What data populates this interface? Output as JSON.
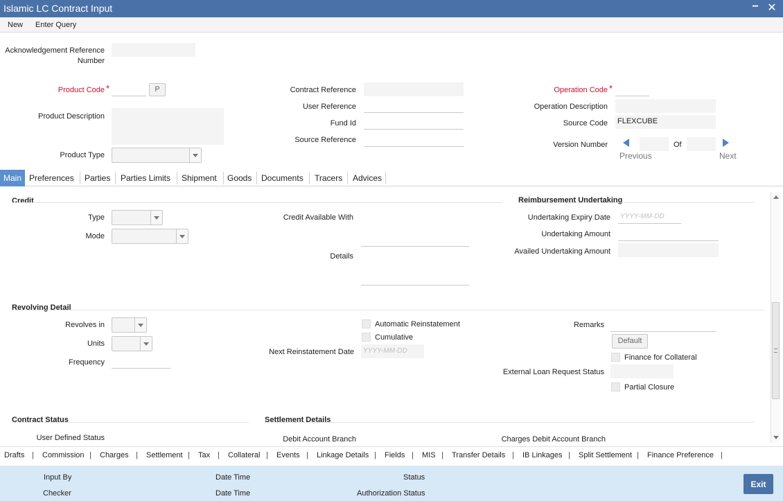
{
  "window": {
    "title": "Islamic LC Contract Input",
    "minimize": "−",
    "close": "✕"
  },
  "menu": {
    "new": "New",
    "enter_query": "Enter Query"
  },
  "header": {
    "ack_ref_label_1": "Acknowledgement Reference",
    "ack_ref_label_2": "Number",
    "product_code_label": "Product Code",
    "product_code_lookup": "P",
    "product_description_label": "Product Description",
    "product_type_label": "Product Type",
    "contract_reference_label": "Contract Reference",
    "user_reference_label": "User Reference",
    "fund_id_label": "Fund Id",
    "source_reference_label": "Source Reference",
    "operation_code_label": "Operation Code",
    "operation_description_label": "Operation Description",
    "source_code_label": "Source Code",
    "source_code_value": "FLEXCUBE",
    "version_number_label": "Version Number",
    "of_label": "Of",
    "previous_label": "Previous",
    "next_label": "Next",
    "required_mark": "*"
  },
  "tabs": [
    "Main",
    "Preferences",
    "Parties",
    "Parties Limits",
    "Shipment",
    "Goods",
    "Documents",
    "Tracers",
    "Advices"
  ],
  "credit": {
    "section_title": "Credit",
    "type_label": "Type",
    "mode_label": "Mode",
    "credit_available_with_label": "Credit Available With",
    "details_label": "Details"
  },
  "reimbursement": {
    "section_title": "Reimbursement Undertaking",
    "expiry_date_label": "Undertaking Expiry Date",
    "expiry_date_placeholder": "YYYY-MM-DD",
    "amount_label": "Undertaking Amount",
    "availed_amount_label": "Availed Undertaking Amount"
  },
  "revolving": {
    "section_title": "Revolving Detail",
    "revolves_in_label": "Revolves in",
    "units_label": "Units",
    "frequency_label": "Frequency",
    "automatic_reinstatement_label": "Automatic Reinstatement",
    "cumulative_label": "Cumulative",
    "next_reinstatement_date_label": "Next Reinstatement Date",
    "next_reinstatement_placeholder": "YYYY-MM-DD",
    "remarks_label": "Remarks",
    "default_button": "Default",
    "finance_for_collateral_label": "Finance for Collateral",
    "external_loan_status_label": "External Loan Request Status",
    "partial_closure_label": "Partial Closure"
  },
  "contract_status": {
    "section_title": "Contract Status",
    "user_defined_status_label": "User Defined Status"
  },
  "settlement": {
    "section_title": "Settlement Details",
    "debit_account_branch_label": "Debit Account Branch",
    "charges_debit_account_branch_label": "Charges Debit Account Branch"
  },
  "bottom_links": [
    "Drafts",
    "Commission",
    "Charges",
    "Settlement",
    "Tax",
    "Collateral",
    "Events",
    "Linkage Details",
    "Fields",
    "MIS",
    "Transfer Details",
    "IB Linkages",
    "Split Settlement",
    "Finance Preference"
  ],
  "bottom_separator": "|",
  "footer": {
    "input_by_label": "Input By",
    "checker_label": "Checker",
    "date_time_label_1": "Date Time",
    "date_time_label_2": "Date Time",
    "status_label": "Status",
    "authorization_status_label": "Authorization Status",
    "exit_button": "Exit"
  },
  "colors": {
    "titlebar": "#4a72a8",
    "active_tab": "#5b8fcd",
    "required": "#c8102e",
    "footer": "#d7e8f7",
    "nav_arrow": "#4f83c4"
  }
}
